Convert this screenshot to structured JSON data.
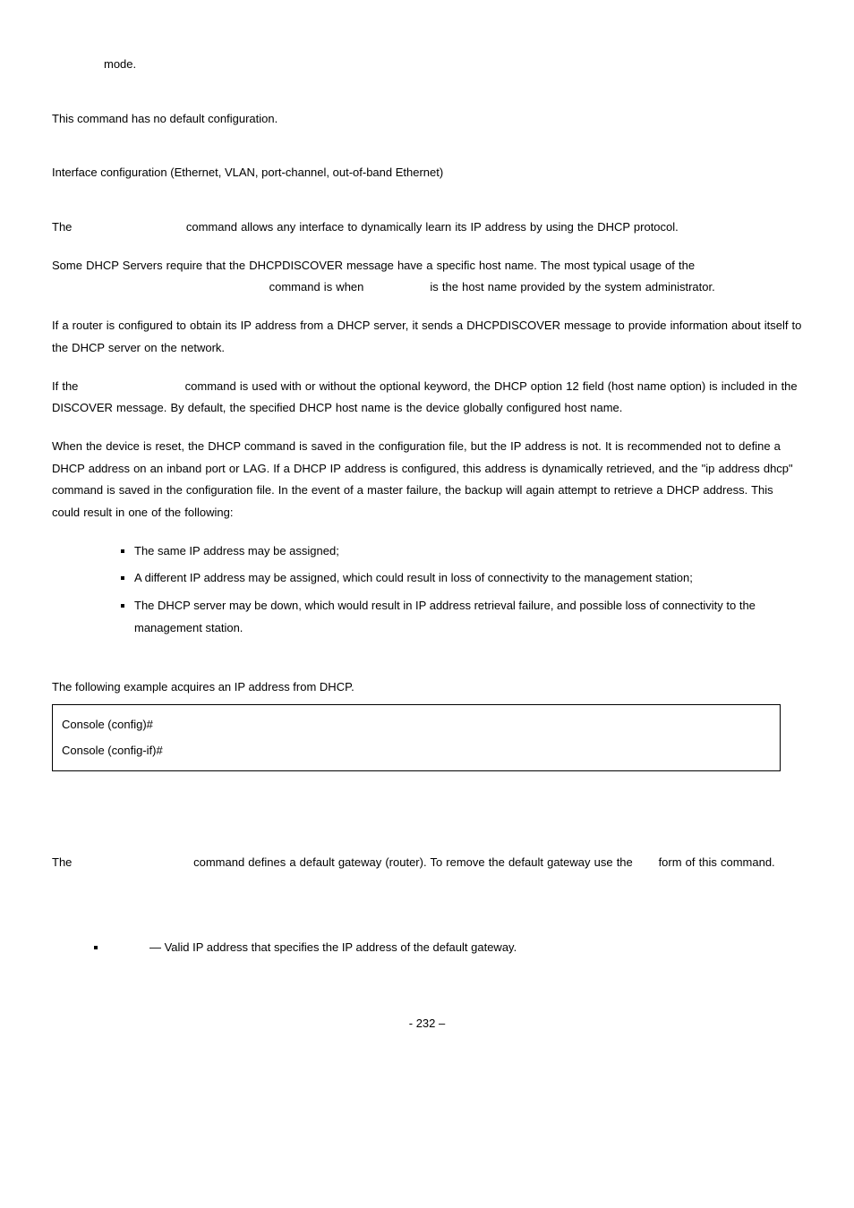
{
  "line_mode": "mode.",
  "default_config_text": "This command has no default configuration.",
  "command_mode_text": "Interface configuration (Ethernet, VLAN, port-channel, out-of-band Ethernet)",
  "ug": {
    "p1_a": "The",
    "p1_b": "command allows any interface to dynamically learn its IP address by using the DHCP protocol.",
    "p2_a": "Some DHCP Servers require that the DHCPDISCOVER message have a specific host name. The most typical usage of the",
    "p2_b": "command is when",
    "p2_c": "is the host name provided by the system administrator.",
    "p3": "If a router is configured to obtain its IP address from a DHCP server, it sends a DHCPDISCOVER message to provide information about itself to the DHCP server on the network.",
    "p4_a": "If the",
    "p4_b": "command is used with or without the optional keyword, the DHCP option 12 field (host name option) is included in the DISCOVER message. By default, the specified DHCP host name is the device globally configured host name.",
    "p5": "When the device is reset, the DHCP command is saved in the configuration file, but the IP address is not. It is recommended not to define a DHCP address on an inband port or LAG. If a DHCP IP address is configured, this address is dynamically retrieved, and the \"ip address dhcp\" command is saved in the configuration file. In the event of a master failure, the backup will again attempt to retrieve a DHCP address. This could result in one of the following:"
  },
  "bullets": {
    "b1": "The same IP address may be assigned;",
    "b2": "A different IP address may be assigned, which could result in loss of connectivity to the management station;",
    "b3": "The DHCP server may be down, which would result in IP address retrieval failure, and possible loss of connectivity to the management station."
  },
  "example_intro": "The following example acquires an IP address from DHCP.",
  "code": {
    "l1": "Console (config)#",
    "l2": "Console (config-if)#"
  },
  "gateway": {
    "p1_a": "The",
    "p1_b": "command defines a default gateway (router). To remove the default gateway use the",
    "p1_c": "form of this command.",
    "param": "— Valid IP address that specifies the IP address of the default gateway."
  },
  "page_number": "- 232 –"
}
